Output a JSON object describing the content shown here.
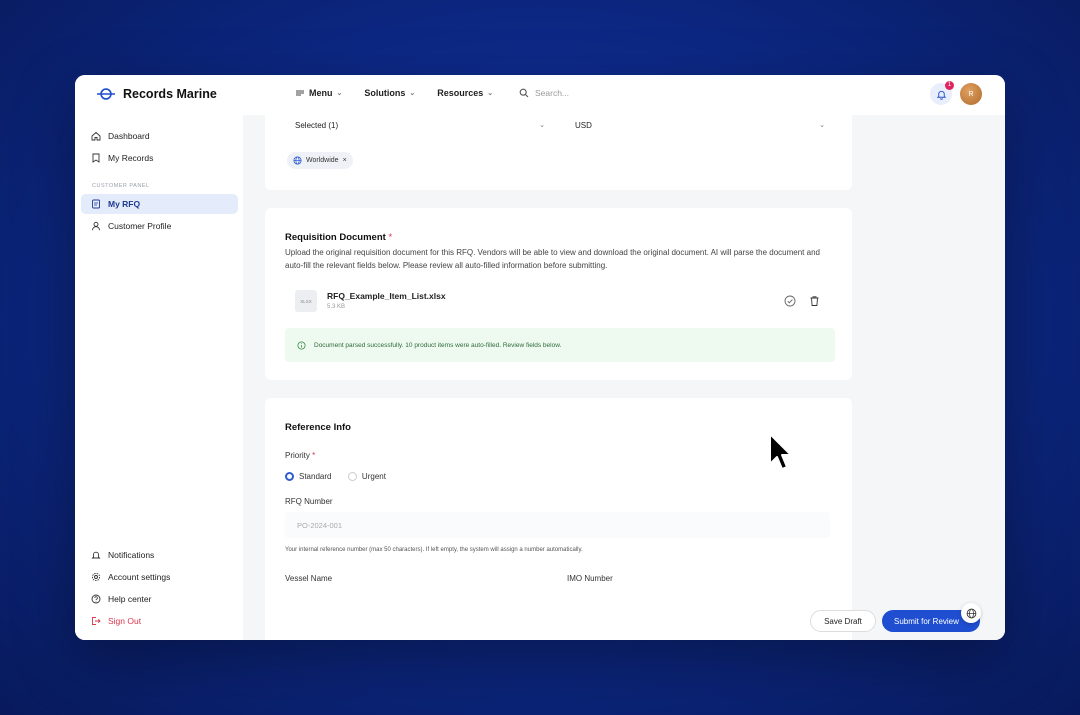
{
  "header": {
    "brand": "Records Marine",
    "nav": [
      {
        "label": "Menu"
      },
      {
        "label": "Solutions"
      },
      {
        "label": "Resources"
      }
    ],
    "search_placeholder": "Search...",
    "notification_count": "1",
    "avatar_initial": "R"
  },
  "sidebar": {
    "items_top": [
      {
        "label": "Dashboard",
        "icon": "home-icon"
      },
      {
        "label": "My Records",
        "icon": "bookmark-icon"
      }
    ],
    "section_label": "CUSTOMER PANEL",
    "items_panel": [
      {
        "label": "My RFQ",
        "icon": "document-icon",
        "active": true
      },
      {
        "label": "Customer Profile",
        "icon": "user-icon"
      }
    ],
    "items_bottom": [
      {
        "label": "Notifications",
        "icon": "bell-icon"
      },
      {
        "label": "Account settings",
        "icon": "gear-icon"
      },
      {
        "label": "Help center",
        "icon": "help-icon"
      },
      {
        "label": "Sign Out",
        "icon": "sign-out-icon"
      }
    ]
  },
  "top_card": {
    "region_select": "Selected (1)",
    "currency_select": "USD",
    "chip_label": "Worldwide",
    "chip_remove": "×"
  },
  "requisition": {
    "title": "Requisition Document",
    "required_mark": "*",
    "description": "Upload the original requisition document for this RFQ. Vendors will be able to view and download the original document. AI will parse the document and auto-fill the relevant fields below. Please review all auto-filled information before submitting.",
    "file_type": "XLSX",
    "file_name": "RFQ_Example_Item_List.xlsx",
    "file_size": "5.3 KB",
    "success_message": "Document parsed successfully. 10 product items were auto-filled. Review fields below."
  },
  "reference": {
    "title": "Reference Info",
    "priority_label": "Priority",
    "priority_required": "*",
    "priority_options": [
      {
        "label": "Standard",
        "selected": true
      },
      {
        "label": "Urgent",
        "selected": false
      }
    ],
    "rfq_number_label": "RFQ Number",
    "rfq_number_placeholder": "PO-2024-001",
    "rfq_hint": "Your internal reference number (max 50 characters). If left empty, the system will assign a number automatically.",
    "vessel_label": "Vessel Name",
    "imo_label": "IMO Number"
  },
  "actions": {
    "save_draft": "Save Draft",
    "submit": "Submit for Review"
  },
  "colors": {
    "accent": "#1f4fd0",
    "active_bg": "#e4ebfb",
    "danger": "#d9364e",
    "success_bg": "#eefaf0"
  }
}
